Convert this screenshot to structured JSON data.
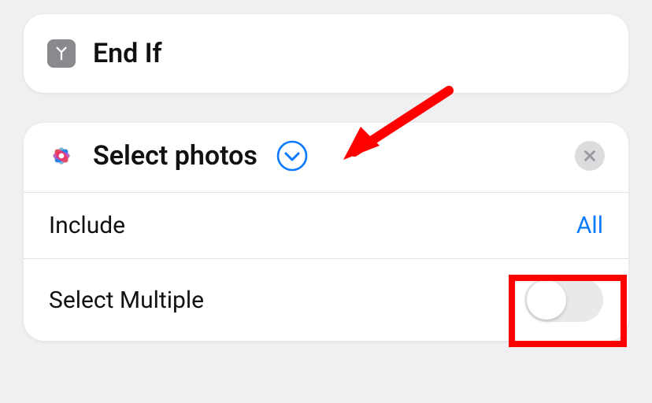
{
  "endIf": {
    "label": "End If"
  },
  "selectPhotos": {
    "title": "Select photos",
    "options": {
      "includeLabel": "Include",
      "includeValue": "All",
      "selectMultipleLabel": "Select Multiple",
      "selectMultipleOn": false
    }
  },
  "annotations": {
    "arrowTarget": "chevron-expand-icon",
    "highlightTarget": "select-multiple-toggle"
  }
}
